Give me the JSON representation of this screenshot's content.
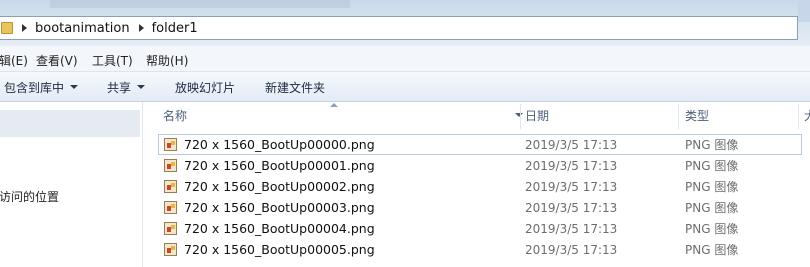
{
  "address": {
    "crumbs": [
      "bootanimation",
      "folder1"
    ]
  },
  "menu": [
    "编辑(E)",
    "查看(V)",
    "工具(T)",
    "帮助(H)"
  ],
  "menu_visible": [
    "辑(E)",
    "查看(V)",
    "工具(T)",
    "帮助(H)"
  ],
  "commands": {
    "include_library": "包含到库中",
    "share": "共享",
    "slideshow": "放映幻灯片",
    "new_folder": "新建文件夹"
  },
  "nav": {
    "recent_places": "访问的位置"
  },
  "columns": {
    "name": "名称",
    "date": "日期",
    "type": "类型",
    "size_partial": "大"
  },
  "files": [
    {
      "name": "720 x 1560_BootUp00000.png",
      "date": "2019/3/5 17:13",
      "type": "PNG 图像"
    },
    {
      "name": "720 x 1560_BootUp00001.png",
      "date": "2019/3/5 17:13",
      "type": "PNG 图像"
    },
    {
      "name": "720 x 1560_BootUp00002.png",
      "date": "2019/3/5 17:13",
      "type": "PNG 图像"
    },
    {
      "name": "720 x 1560_BootUp00003.png",
      "date": "2019/3/5 17:13",
      "type": "PNG 图像"
    },
    {
      "name": "720 x 1560_BootUp00004.png",
      "date": "2019/3/5 17:13",
      "type": "PNG 图像"
    },
    {
      "name": "720 x 1560_BootUp00005.png",
      "date": "2019/3/5 17:13",
      "type": "PNG 图像"
    }
  ]
}
